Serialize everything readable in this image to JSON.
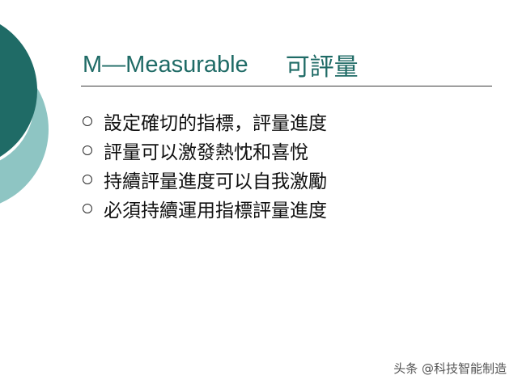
{
  "slide": {
    "title_en": "M—Measurable",
    "title_cn": "可評量",
    "accent_color": "#1f6b66",
    "bullet_icon": "hollow-circle-icon",
    "bullets": [
      "設定確切的指標，評量進度",
      "評量可以激發熱忱和喜悅",
      "持續評量進度可以自我激勵",
      "必須持續運用指標評量進度"
    ]
  },
  "watermark": {
    "text": "头条 @科技智能制造"
  }
}
